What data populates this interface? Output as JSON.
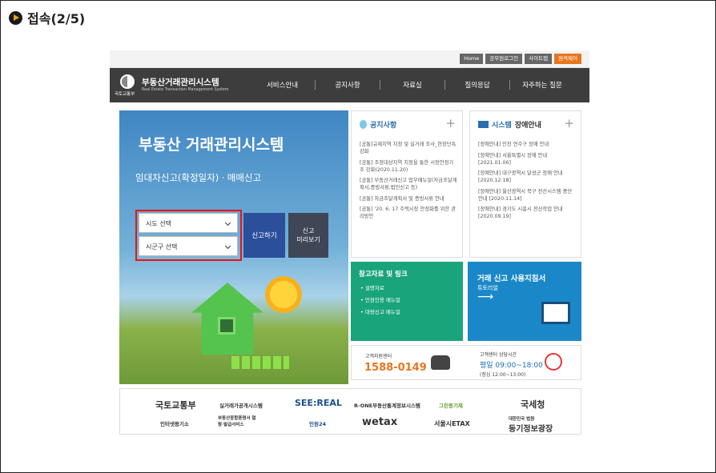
{
  "heading": "접속(2/5)",
  "utils": [
    "Home",
    "공무원로그인",
    "사이트맵",
    "원격제어"
  ],
  "logo": {
    "org": "국토교통부",
    "title": "부동산거래관리시스템",
    "subtitle": "Real Estate Transaction Management System"
  },
  "menu": [
    "서비스안내",
    "공지사항",
    "자료실",
    "질의응답",
    "자주하는 질문"
  ],
  "hero": {
    "title": "부동산 거래관리시스템",
    "subtitle": "임대차신고(확정일자)ㆍ매매신고",
    "sido_select": "시도 선택",
    "sigungu_select": "시군구 선택",
    "report_button": "신고하기",
    "preview_button_line1": "신고",
    "preview_button_line2": "미리보기"
  },
  "notice": {
    "title": "공지사항",
    "items": [
      "[공통]규제지역 지정 및 실거래 조사_현장단속 강화",
      "[공통] 조정대상지역 지정을 통한 시장안정기조 강화(2020.11.20)",
      "[공통] 부동산거래신고 업무매뉴얼(자금조달계획서,증빙서류,법인신고 등)",
      "[공통] 자금조달계획서 및 증빙서류 안내",
      "[공통] '20. 6. 17 주택시장 안정화를 위한 관리방안"
    ]
  },
  "outage": {
    "title_blue": "시스템",
    "title_rest": "장애안내",
    "items": [
      "[장애안내] 인천 연수구 장애 안내",
      "[장애안내] 서울특별시 장애 안내 [2021.01.06]",
      "[장애안내] 대구광역시 달성군 장애 안내 [2020.12.18]",
      "[장애안내] 울산광역시 북구 전산시스템 중단안내 [2020.11.14]",
      "[장애안내] 경기도 시흥시 전산작업 안내 [2020.09.19]"
    ]
  },
  "resources": {
    "title": "참고자료 및 링크",
    "links": [
      "설명자료",
      "민원인용 매뉴얼",
      "대량신고 매뉴얼"
    ]
  },
  "guide": {
    "title": "거래 신고 사용지침서",
    "sub": "튜토리얼",
    "arrow": "⟶"
  },
  "contact": {
    "center_label": "고객지원센터",
    "number": "1588-0149",
    "hours_label": "고객센터 상담시간",
    "hours": "평일 09:00~18:00",
    "lunch": "(점심 12:00~13:00)"
  },
  "footer": {
    "molit": "국토교통부",
    "rtms": "실거래가공개시스템",
    "seereal": "SEE:REAL",
    "rone": "R-ONE부동산통계정보시스템",
    "green": "그린등기재",
    "nts": "국세청",
    "cert": "인터넷등기소",
    "doc": "부동산종합증명서 열람·발급서비스",
    "minwon": "민원24",
    "wetax": "wetax",
    "etax": "서울시ETAX",
    "court1": "대한민국 법원",
    "court2": "등기정보광장"
  }
}
